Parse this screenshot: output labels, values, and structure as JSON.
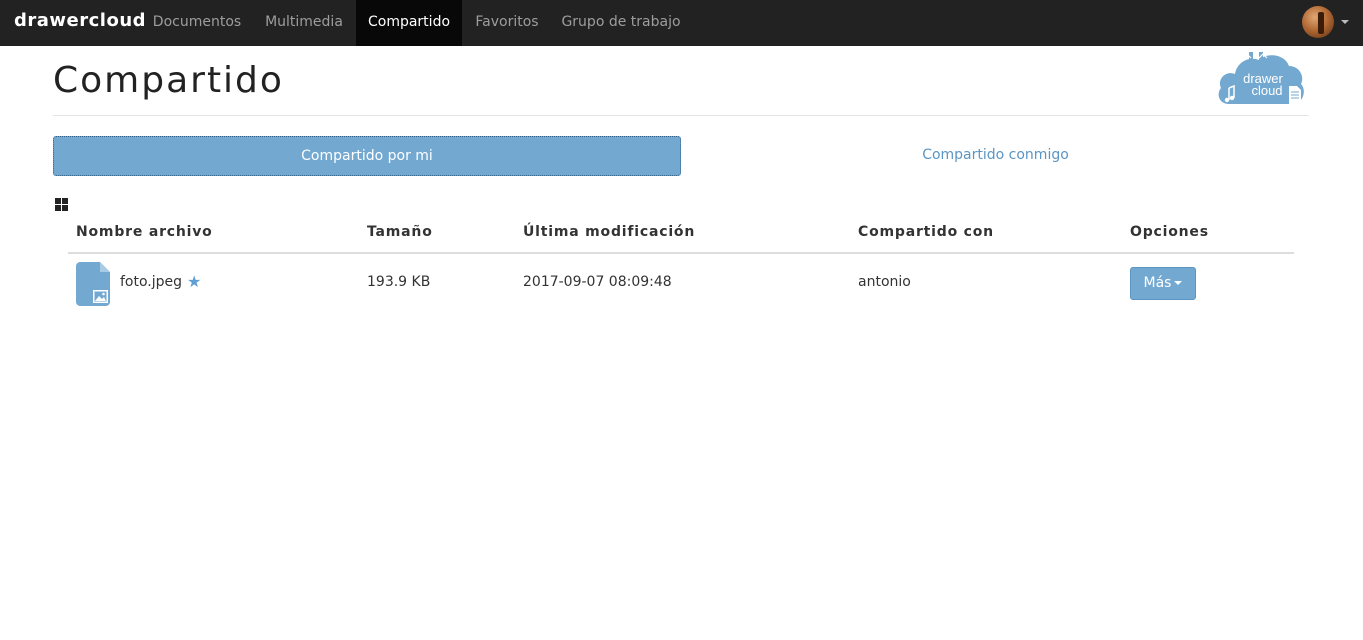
{
  "navbar": {
    "brand": "drawercloud",
    "items": [
      {
        "label": "Documentos",
        "active": false
      },
      {
        "label": "Multimedia",
        "active": false
      },
      {
        "label": "Compartido",
        "active": true
      },
      {
        "label": "Favoritos",
        "active": false
      },
      {
        "label": "Grupo de trabajo",
        "active": false
      }
    ]
  },
  "page": {
    "title": "Compartido",
    "logo_text_line1": "drawer",
    "logo_text_line2": "cloud"
  },
  "tabs": [
    {
      "label": "Compartido por mi",
      "active": true
    },
    {
      "label": "Compartido conmigo",
      "active": false
    }
  ],
  "table": {
    "headers": [
      "Nombre archivo",
      "Tamaño",
      "Última modificación",
      "Compartido con",
      "Opciones"
    ],
    "rows": [
      {
        "name": "foto.jpeg",
        "size": "193.9 KB",
        "modified": "2017-09-07 08:09:48",
        "shared_with": "antonio",
        "favorite": true,
        "options_label": "Más"
      }
    ]
  },
  "colors": {
    "navbar_bg": "#222222",
    "accent": "#73a8d1",
    "link": "#5a95c4"
  }
}
